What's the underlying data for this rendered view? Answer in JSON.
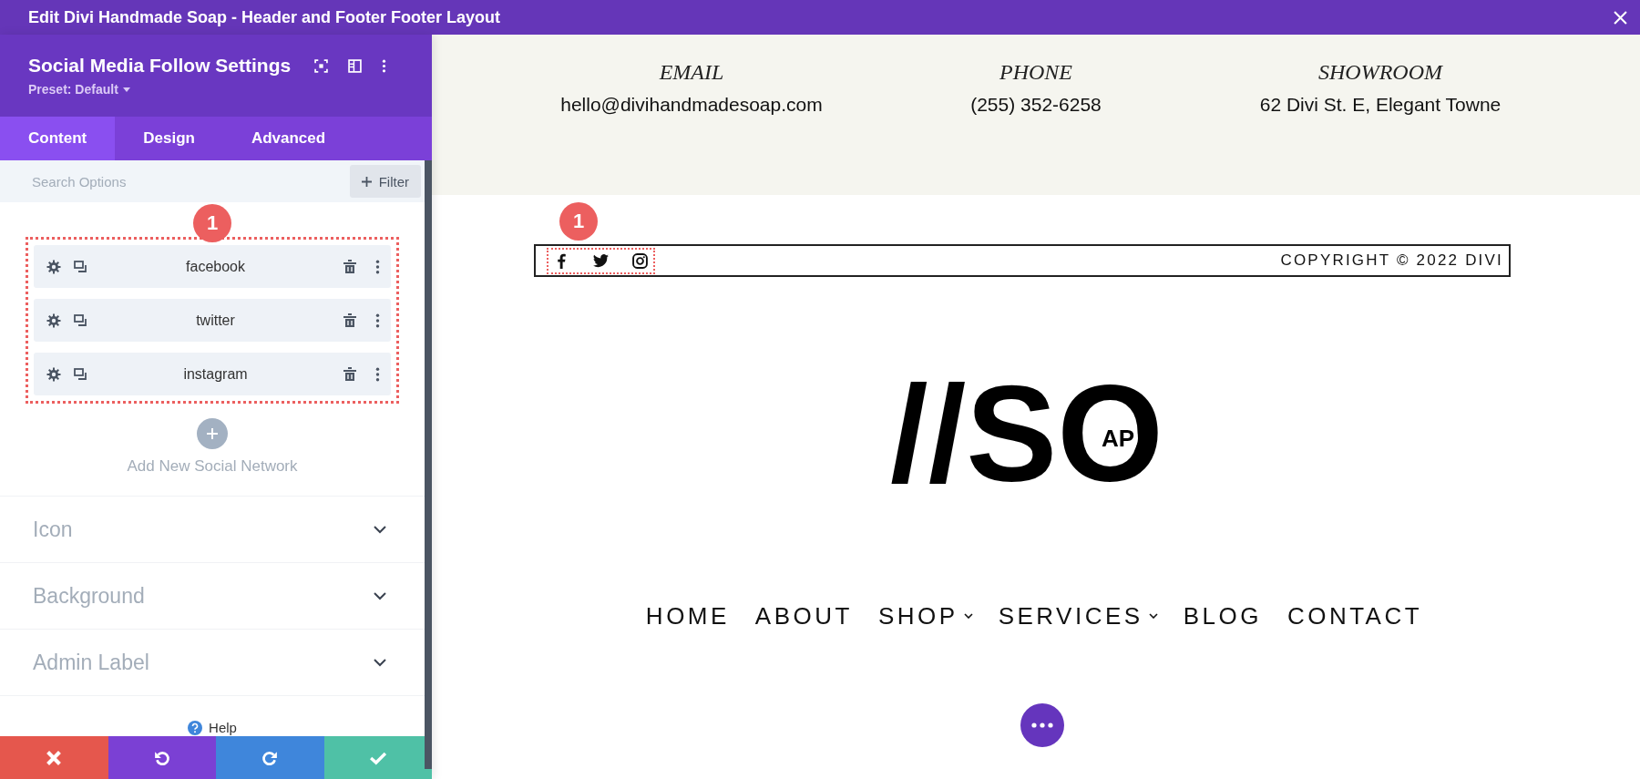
{
  "window": {
    "title": "Edit Divi Handmade Soap - Header and Footer Footer Layout"
  },
  "panel": {
    "title": "Social Media Follow Settings",
    "preset": "Preset: Default",
    "tabs": [
      {
        "label": "Content",
        "selected": true
      },
      {
        "label": "Design",
        "selected": false
      },
      {
        "label": "Advanced",
        "selected": false
      }
    ],
    "search": {
      "placeholder": "Search Options"
    },
    "filter_button": "Filter",
    "badge": "1",
    "networks": [
      {
        "label": "facebook"
      },
      {
        "label": "twitter"
      },
      {
        "label": "instagram"
      }
    ],
    "add_label": "Add New Social Network",
    "sections": [
      {
        "label": "Icon",
        "expanded": false
      },
      {
        "label": "Background",
        "expanded": false
      },
      {
        "label": "Admin Label",
        "expanded": false
      }
    ],
    "help": "Help",
    "actions": [
      {
        "kind": "cancel"
      },
      {
        "kind": "undo"
      },
      {
        "kind": "redo"
      },
      {
        "kind": "save"
      }
    ]
  },
  "page": {
    "contacts": [
      {
        "label": "EMAIL",
        "value": "hello@divihandmadesoap.com"
      },
      {
        "label": "PHONE",
        "value": "(255) 352-6258"
      },
      {
        "label": "SHOWROOM",
        "value": "62 Divi St. E, Elegant Towne"
      }
    ],
    "badge": "1",
    "social_icons": [
      {
        "kind": "facebook"
      },
      {
        "kind": "twitter"
      },
      {
        "kind": "instagram"
      }
    ],
    "copyright": "COPYRIGHT © 2022 DIVI",
    "logo": {
      "main": "//SO",
      "inner": "AP"
    },
    "nav": [
      {
        "label": "HOME",
        "dropdown": false
      },
      {
        "label": "ABOUT",
        "dropdown": false
      },
      {
        "label": "SHOP",
        "dropdown": true
      },
      {
        "label": "SERVICES",
        "dropdown": true
      },
      {
        "label": "BLOG",
        "dropdown": false
      },
      {
        "label": "CONTACT",
        "dropdown": false
      }
    ]
  }
}
